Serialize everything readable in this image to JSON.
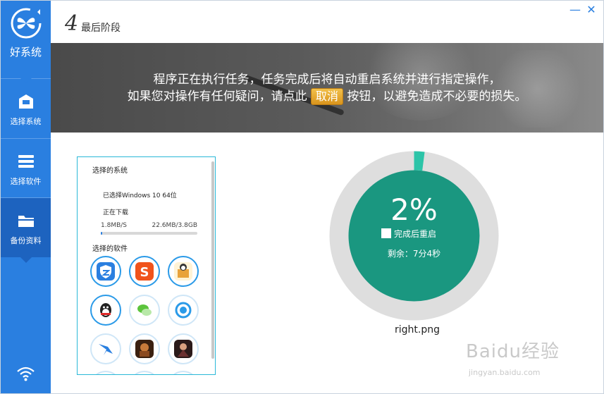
{
  "sidebar": {
    "brand_name": "好系统",
    "items": [
      {
        "label": "选择系统",
        "icon": "system-icon"
      },
      {
        "label": "选择软件",
        "icon": "menu-icon"
      },
      {
        "label": "备份资料",
        "icon": "folder-icon"
      }
    ],
    "active_index": 2,
    "bottom_icon": "wifi-icon",
    "color": "#2a7fe0",
    "active_color": "#1d63bf"
  },
  "header": {
    "step_number": "4",
    "step_title": "最后阶段",
    "minimize_glyph": "—",
    "close_glyph": "✕"
  },
  "banner": {
    "line1": "程序正在执行任务，任务完成后将自动重启系统并进行指定操作，",
    "line2_before": "如果您对操作有任何疑问，请点此",
    "cancel_label": "取消",
    "line2_after": "按钮，以避免造成不必要的损失。"
  },
  "panel": {
    "system_title": "选择的系统",
    "selected_system": "已选择Windows 10 64位",
    "status": "正在下载",
    "speed": "1.8MB/S",
    "size": "22.6MB/3.8GB",
    "download_progress": 0.006,
    "software_title": "选择的软件",
    "apps": [
      {
        "icon": "security-shield-icon",
        "color": "#2a7fe0"
      },
      {
        "icon": "sogou-input-icon",
        "color": "#f0531b"
      },
      {
        "icon": "package-icon",
        "color": "#e8a23a"
      },
      {
        "icon": "qq-penguin-icon",
        "color": "#222222"
      },
      {
        "icon": "wechat-icon",
        "color": "#5cc43c"
      },
      {
        "icon": "browser-icon",
        "color": "#2a9ae8"
      },
      {
        "icon": "bird-app-icon",
        "color": "#2a7fe0"
      },
      {
        "icon": "game-icon",
        "color": "#8a4a20"
      },
      {
        "icon": "game-character-icon",
        "color": "#6a3030"
      }
    ]
  },
  "dial": {
    "percent": 2,
    "percent_text": "2%",
    "restart_label": "完成后重启",
    "remaining": "剩余：7分4秒",
    "ring_color": "#dedede",
    "fill_color": "#1a9780",
    "arc_color": "#2cc4a8"
  },
  "caption": "right.png",
  "watermark": {
    "text": "Baidu经验",
    "url": "jingyan.baidu.com"
  }
}
